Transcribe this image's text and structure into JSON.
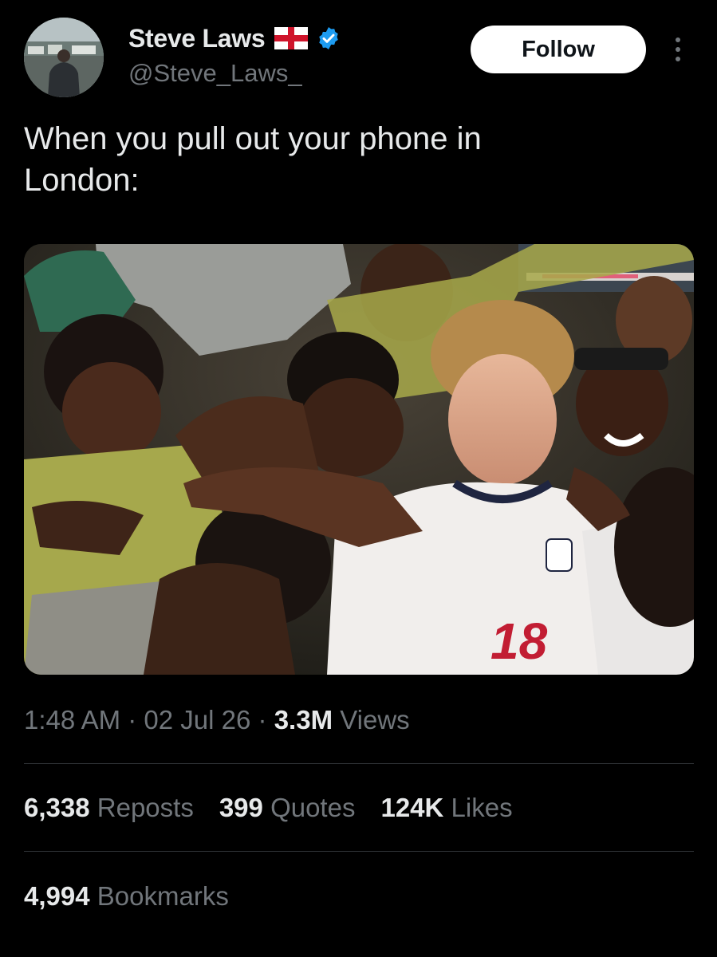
{
  "colors": {
    "background": "#000000",
    "primary_text": "#e7e9ea",
    "secondary_text": "#71767b",
    "verified_blue": "#1d9bf0",
    "follow_button_bg": "#ffffff",
    "divider": "#2f3336"
  },
  "author": {
    "display_name": "Steve Laws",
    "handle": "@Steve_Laws_",
    "flag_icon": "england-flag-icon",
    "verified_icon": "verified-badge-icon"
  },
  "actions": {
    "follow_label": "Follow",
    "more_icon": "more-options-icon"
  },
  "tweet": {
    "text": "When you pull out your phone in\nLondon:"
  },
  "media": {
    "jersey_number": "18"
  },
  "meta": {
    "time": "1:48 AM",
    "separator": "·",
    "date": "02 Jul 26",
    "views_count": "3.3M",
    "views_label": "Views"
  },
  "stats": {
    "reposts_count": "6,338",
    "reposts_label": "Reposts",
    "quotes_count": "399",
    "quotes_label": "Quotes",
    "likes_count": "124K",
    "likes_label": "Likes",
    "bookmarks_count": "4,994",
    "bookmarks_label": "Bookmarks"
  }
}
